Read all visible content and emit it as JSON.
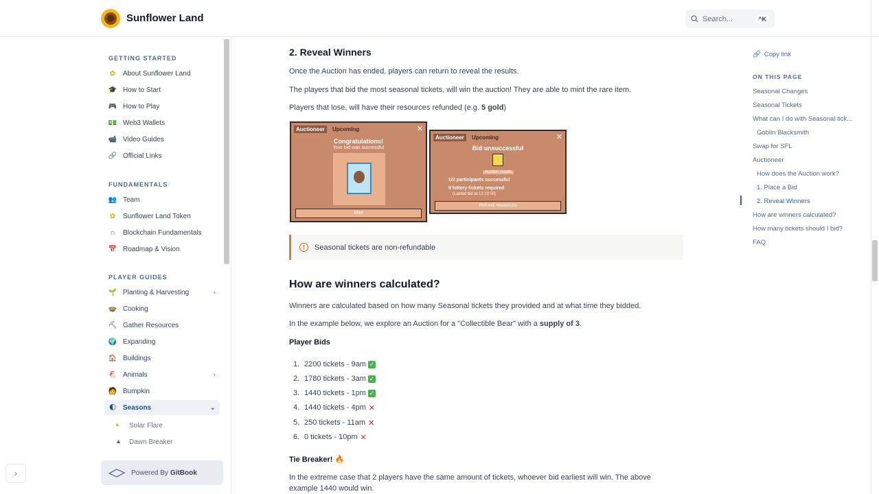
{
  "header": {
    "title": "Sunflower Land",
    "search_placeholder": "Search...",
    "search_shortcut": "^K"
  },
  "sidebar": {
    "sections": [
      {
        "title": "GETTING STARTED",
        "items": [
          "About Sunflower Land",
          "How to Start",
          "How to Play",
          "Web3 Wallets",
          "Video Guides",
          "Official Links"
        ]
      },
      {
        "title": "FUNDAMENTALS",
        "items": [
          "Team",
          "Sunflower Land Token",
          "Blockchain Fundamentals",
          "Roadmap & Vision"
        ]
      },
      {
        "title": "PLAYER GUIDES",
        "items": [
          "Planting & Harvesting",
          "Cooking",
          "Gather Resources",
          "Expanding",
          "Buildings",
          "Animals",
          "Bumpkin",
          "Seasons"
        ]
      }
    ],
    "sub_items": [
      "Solar Flare",
      "Dawn Breaker"
    ],
    "powered_by": "Powered By",
    "gitbook": "GitBook"
  },
  "content": {
    "section_title": "2. Reveal Winners",
    "p1": "Once the Auction has ended, players can return to reveal the results.",
    "p2": "The players that bid the most seasonal tickets, will win the auction! They are able to mint the rare item.",
    "p3_prefix": "Players that lose, will have their resources refunded (e.g. ",
    "p3_bold": "5 gold",
    "p3_suffix": ")",
    "img1": {
      "tab1": "Auctioneer",
      "tab2": "Upcoming",
      "title": "Congratulations!",
      "sub": "Your bid was successful",
      "button": "Mint"
    },
    "img2": {
      "tab1": "Auctioneer",
      "tab2": "Upcoming",
      "title": "Bid unsuccessful",
      "badge": "Auction results",
      "line1": "1/2 participants successful",
      "line2": "9 lottery tickets required",
      "line3": "(Lasted bid at 12:10:50)",
      "button": "Refund resources"
    },
    "note": "Seasonal tickets are non-refundable",
    "heading": "How are winners calculated?",
    "p4": "Winners are calculated based on how many Seasonal tickets they provided and at what time they bidded.",
    "p5_prefix": "In the example below, we explore an Auction for a \"Collectible Bear\" with a ",
    "p5_bold": "supply of 3",
    "p5_suffix": ".",
    "player_bids": "Player Bids",
    "bids": [
      {
        "n": "1.",
        "text": "2200 tickets - 9am",
        "won": true
      },
      {
        "n": "2.",
        "text": "1780 tickets - 3am",
        "won": true
      },
      {
        "n": "3.",
        "text": "1440 tickets - 1pm",
        "won": true
      },
      {
        "n": "4.",
        "text": "1440 tickets - 4pm",
        "won": false
      },
      {
        "n": "5.",
        "text": "250 tickets - 11am",
        "won": false
      },
      {
        "n": "6.",
        "text": "0 tickets - 10pm",
        "won": false
      }
    ],
    "tie_breaker": "Tie Breaker!",
    "p6": "In the extreme case that 2 players have the same amount of tickets, whoever bid earliest will win. The above",
    "p7": "example 1440 would win."
  },
  "toc": {
    "copy_link": "Copy link",
    "on_this_page": "ON THIS PAGE",
    "items": [
      "Seasonal Changes",
      "Seasonal Tickets",
      "What can I do with Seasonal tick...",
      "Goblin Blacksmith",
      "Swap for SFL",
      "Auctioneer",
      "How does the Auction work?",
      "1. Place a Bid",
      "2. Reveal Winners",
      "How are winners calculated?",
      "How many tickets should I bid?",
      "FAQ"
    ]
  }
}
